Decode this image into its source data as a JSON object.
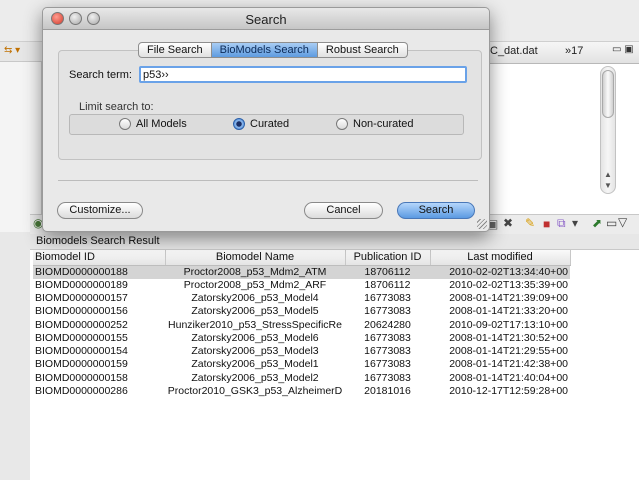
{
  "background": {
    "editor_tab": "C_dat.dat",
    "editor_more": "»17"
  },
  "dialog": {
    "title": "Search",
    "tabs": [
      {
        "label": "File Search",
        "active": false
      },
      {
        "label": "BioModels Search",
        "active": true
      },
      {
        "label": "Robust Search",
        "active": false
      }
    ],
    "search_label": "Search term:",
    "search_value": "p53››",
    "limit_label": "Limit search to:",
    "radios": [
      {
        "label": "All Models",
        "checked": false
      },
      {
        "label": "Curated",
        "checked": true
      },
      {
        "label": "Non-curated",
        "checked": false
      }
    ],
    "customize_label": "Customize...",
    "cancel_label": "Cancel",
    "search_button_label": "Search"
  },
  "results": {
    "title": "Biomodels Search Result",
    "columns": [
      "Biomodel ID",
      "Biomodel Name",
      "Publication  ID",
      "Last modified"
    ],
    "rows": [
      [
        "BIOMD0000000188",
        "Proctor2008_p53_Mdm2_ATM",
        "18706112",
        "2010-02-02T13:34:40+00"
      ],
      [
        "BIOMD0000000189",
        "Proctor2008_p53_Mdm2_ARF",
        "18706112",
        "2010-02-02T13:35:39+00"
      ],
      [
        "BIOMD0000000157",
        "Zatorsky2006_p53_Model4",
        "16773083",
        "2008-01-14T21:39:09+00"
      ],
      [
        "BIOMD0000000156",
        "Zatorsky2006_p53_Model5",
        "16773083",
        "2008-01-14T21:33:20+00"
      ],
      [
        "BIOMD0000000252",
        "Hunziker2010_p53_StressSpecificRe",
        "20624280",
        "2010-09-02T17:13:10+00"
      ],
      [
        "BIOMD0000000155",
        "Zatorsky2006_p53_Model6",
        "16773083",
        "2008-01-14T21:30:52+00"
      ],
      [
        "BIOMD0000000154",
        "Zatorsky2006_p53_Model3",
        "16773083",
        "2008-01-14T21:29:55+00"
      ],
      [
        "BIOMD0000000159",
        "Zatorsky2006_p53_Model1",
        "16773083",
        "2008-01-14T21:42:38+00"
      ],
      [
        "BIOMD0000000158",
        "Zatorsky2006_p53_Model2",
        "16773083",
        "2008-01-14T21:40:04+00"
      ],
      [
        "BIOMD0000000286",
        "Proctor2010_GSK3_p53_AlzheimerD",
        "20181016",
        "2010-12-17T12:59:28+00"
      ]
    ]
  }
}
